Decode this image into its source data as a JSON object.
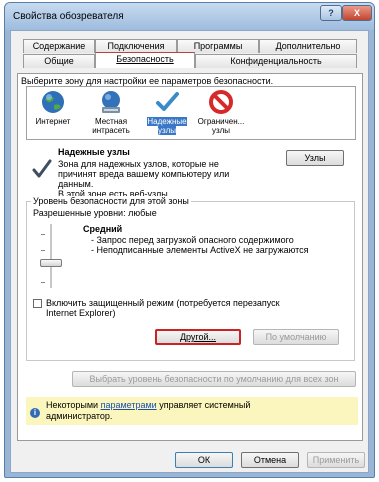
{
  "window": {
    "title": "Свойства обозревателя",
    "help_label": "?",
    "close_label": "X"
  },
  "tabs": {
    "row1": [
      "Содержание",
      "Подключения",
      "Программы",
      "Дополнительно"
    ],
    "row2": [
      "Общие",
      "Безопасность",
      "Конфиденциальность"
    ],
    "active": "Безопасность"
  },
  "zones": {
    "prompt": "Выберите зону для настройки ее параметров безопасности.",
    "items": [
      {
        "line1": "Интернет",
        "line2": "",
        "icon": "globe-icon"
      },
      {
        "line1": "Местная",
        "line2": "интрасеть",
        "icon": "intranet-icon"
      },
      {
        "line1": "Надежные",
        "line2": "узлы",
        "icon": "checkmark-icon",
        "selected": true
      },
      {
        "line1": "Ограничен...",
        "line2": "узлы",
        "icon": "restricted-icon"
      }
    ]
  },
  "zone_info": {
    "title": "Надежные узлы",
    "description": [
      "Зона для надежных узлов, которые не",
      "причинят вреда вашему компьютеру или",
      "данным."
    ],
    "sites_note": "В этой зоне есть веб-узлы.",
    "sites_button": "Узлы"
  },
  "security_level": {
    "group_title": "Уровень безопасности для этой зоны",
    "allowed": "Разрешенные уровни: любые",
    "level_name": "Средний",
    "bullets": [
      "- Запрос перед загрузкой опасного содержимого",
      "- Неподписанные элементы ActiveX не загружаются"
    ],
    "protected_mode_line1": "Включить защищенный режим (потребуется перезапуск",
    "protected_mode_line2": "Internet Explorer)",
    "protected_mode_checked": false,
    "custom_button": "Другой...",
    "default_button": "По умолчанию"
  },
  "reset_all_button": "Выбрать уровень безопасности по умолчанию для всех зон",
  "admin_info": {
    "line1_pre": "Некоторыми ",
    "line1_link": "параметрами",
    "line1_post": " управляет системный",
    "line2": "администратор."
  },
  "footer": {
    "ok": "ОК",
    "cancel": "Отмена",
    "apply": "Применить"
  },
  "colors": {
    "highlight_border": "#cc2222",
    "selected_zone": "#3a77c6",
    "info_bar": "#fbf6bd"
  }
}
